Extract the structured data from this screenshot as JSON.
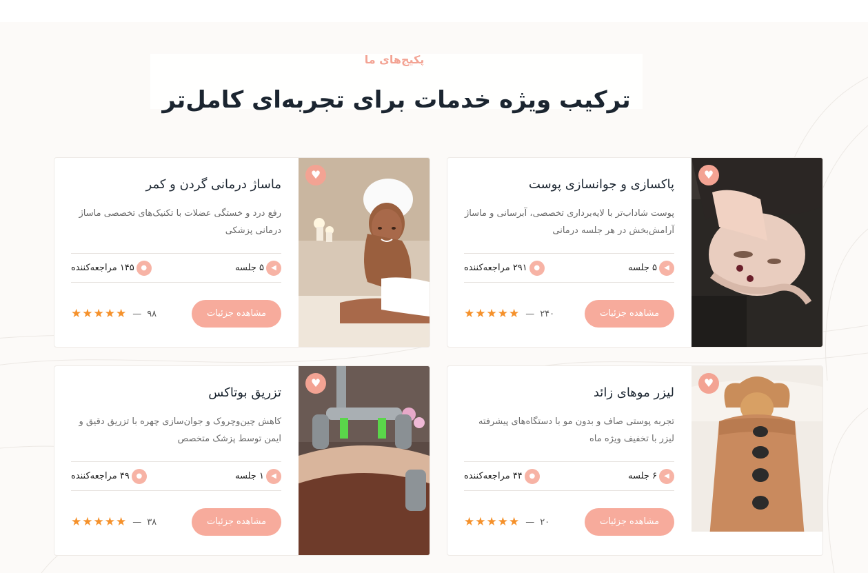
{
  "header": {
    "eyebrow": "پکیج‌های ما",
    "title": "ترکیب ویژه خدمات برای تجربه‌ای کامل‌تر"
  },
  "colors": {
    "accent": "#f3a393",
    "button": "#f7ab9c",
    "star": "#f5912b"
  },
  "packages": [
    {
      "title": "پاکسازی و جوانسازی پوست",
      "description": "پوست شاداب‌تر با لایه‌برداری تخصصی، آبرسانی و ماساژ آرامش‌بخش در هر جلسه درمانی",
      "sessions": "۵ جلسه",
      "visitors": "۲۹۱ مراجعه‌کننده",
      "button": "مشاهده جزئیات",
      "stars": "★★★★★",
      "reviews": "۲۴۰",
      "image": "facial-treatment"
    },
    {
      "title": "ماساژ درمانی گردن و کمر",
      "description": "رفع درد و خستگی عضلات با تکنیک‌های تخصصی ماساژ درمانی پزشکی",
      "sessions": "۵ جلسه",
      "visitors": "۱۴۵ مراجعه‌کننده",
      "button": "مشاهده جزئیات",
      "stars": "★★★★★",
      "reviews": "۹۸",
      "image": "spa-woman-towel"
    },
    {
      "title": "لیزر موهای زائد",
      "description": "تجربه پوستی صاف و بدون مو با دستگاه‌های پیشرفته لیزر با تخفیف ویژه ماه",
      "sessions": "۶ جلسه",
      "visitors": "۴۴ مراجعه‌کننده",
      "button": "مشاهده جزئیات",
      "stars": "★★★★★",
      "reviews": "۲۰",
      "image": "hot-stone-massage"
    },
    {
      "title": "تزریق بوتاکس",
      "description": "کاهش چین‌وچروک و جوان‌سازی چهره با تزریق دقیق و ایمن توسط پزشک متخصص",
      "sessions": "۱ جلسه",
      "visitors": "۴۹ مراجعه‌کننده",
      "button": "مشاهده جزئیات",
      "stars": "★★★★★",
      "reviews": "۳۸",
      "image": "laser-device"
    }
  ],
  "icons": {
    "favorite": "heart-icon",
    "sessions": "play-icon",
    "visitors": "user-icon",
    "rating": "star-icon"
  }
}
